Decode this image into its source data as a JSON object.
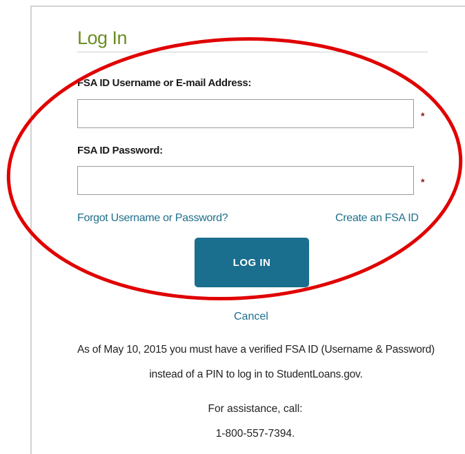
{
  "login": {
    "title": "Log In",
    "username_label": "FSA ID Username or E-mail Address:",
    "username_value": "",
    "password_label": "FSA ID Password:",
    "password_value": "",
    "required_marker": "*",
    "forgot_link": "Forgot Username or Password?",
    "create_link": "Create an FSA ID",
    "login_button": "LOG IN",
    "cancel_link": "Cancel"
  },
  "notice": {
    "text": "As of May 10, 2015 you must have a verified FSA ID (Username & Password) instead of a PIN to log in to StudentLoans.gov."
  },
  "assistance": {
    "line1": "For assistance, call:",
    "phone": "1-800-557-7394."
  },
  "colors": {
    "title_green": "#6b8e23",
    "link_blue": "#1f6f8b",
    "button_teal": "#1a6e8e",
    "required_red": "#8b1a1a",
    "annotation_red": "#e00000"
  }
}
